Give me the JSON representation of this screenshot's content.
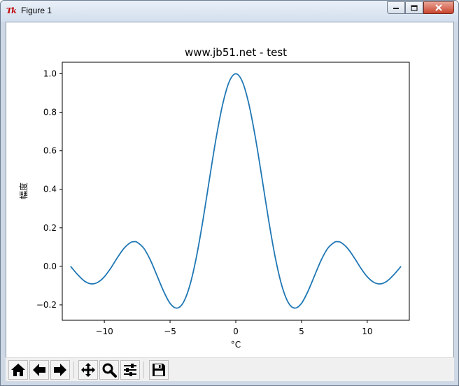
{
  "window": {
    "title": "Figure 1",
    "icon": "tk-feather-icon"
  },
  "toolbar": {
    "buttons": [
      {
        "name": "home-button",
        "icon": "home-icon"
      },
      {
        "name": "back-button",
        "icon": "arrow-left-icon"
      },
      {
        "name": "forward-button",
        "icon": "arrow-right-icon"
      },
      {
        "name": "pan-button",
        "icon": "move-icon"
      },
      {
        "name": "zoom-button",
        "icon": "magnifier-icon"
      },
      {
        "name": "configure-subplots-button",
        "icon": "sliders-icon"
      },
      {
        "name": "save-button",
        "icon": "floppy-disk-icon"
      }
    ]
  },
  "chart_data": {
    "type": "line",
    "title": "www.jb51.net - test",
    "xlabel": "°C",
    "ylabel": "幅度",
    "xlim": [
      -13.2,
      13.2
    ],
    "ylim": [
      -0.28,
      1.06
    ],
    "xticks": [
      -10,
      -5,
      0,
      5,
      10
    ],
    "xtick_labels": [
      "−10",
      "−5",
      "0",
      "5",
      "10"
    ],
    "yticks": [
      -0.2,
      0.0,
      0.2,
      0.4,
      0.6,
      0.8,
      1.0
    ],
    "ytick_labels": [
      "−0.2",
      "0.0",
      "0.2",
      "0.4",
      "0.6",
      "0.8",
      "1.0"
    ],
    "grid": false,
    "series": [
      {
        "color": "#1f77b4",
        "x": [
          -12.566,
          -12.0,
          -11.5,
          -11.0,
          -10.5,
          -10.0,
          -9.5,
          -9.0,
          -8.5,
          -8.0,
          -7.725,
          -7.5,
          -7.0,
          -6.5,
          -6.0,
          -5.5,
          -5.0,
          -4.493,
          -4.0,
          -3.5,
          -3.0,
          -2.5,
          -2.0,
          -1.5,
          -1.0,
          -0.5,
          0.0,
          0.5,
          1.0,
          1.5,
          2.0,
          2.5,
          3.0,
          3.5,
          4.0,
          4.493,
          5.0,
          5.5,
          6.0,
          6.5,
          7.0,
          7.5,
          7.725,
          8.0,
          8.5,
          9.0,
          9.5,
          10.0,
          10.5,
          11.0,
          11.5,
          12.0,
          12.566
        ],
        "y": [
          0.0,
          -0.045,
          -0.077,
          -0.091,
          -0.083,
          -0.054,
          -0.008,
          0.046,
          0.094,
          0.124,
          0.128,
          0.125,
          0.094,
          0.033,
          -0.047,
          -0.128,
          -0.192,
          -0.217,
          -0.189,
          -0.1,
          0.047,
          0.239,
          0.455,
          0.665,
          0.841,
          0.959,
          1.0,
          0.959,
          0.841,
          0.665,
          0.455,
          0.239,
          0.047,
          -0.1,
          -0.189,
          -0.217,
          -0.192,
          -0.128,
          -0.047,
          0.033,
          0.094,
          0.125,
          0.128,
          0.124,
          0.094,
          0.046,
          -0.008,
          -0.054,
          -0.083,
          -0.091,
          -0.077,
          -0.045,
          0.0
        ]
      }
    ]
  }
}
